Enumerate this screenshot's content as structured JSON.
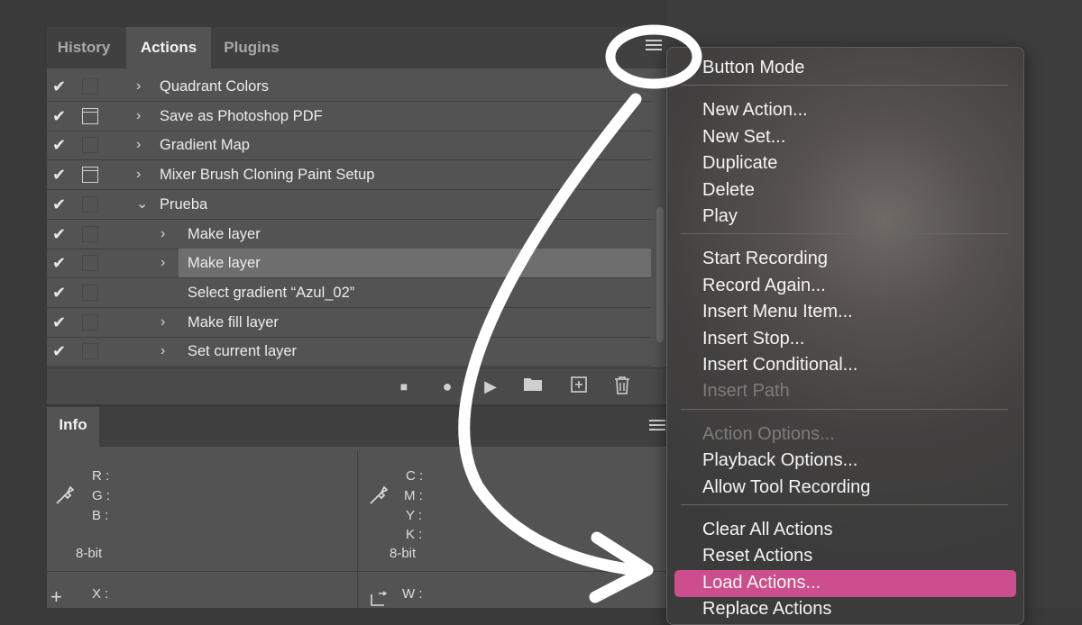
{
  "actions_panel": {
    "tabs": [
      "History",
      "Actions",
      "Plugins"
    ],
    "rows": [
      {
        "label": "Quadrant Colors",
        "chevron": "›",
        "dialog_on": false
      },
      {
        "label": "Save as Photoshop PDF",
        "chevron": "›",
        "dialog_on": true
      },
      {
        "label": "Gradient Map",
        "chevron": "›",
        "dialog_on": false
      },
      {
        "label": "Mixer Brush Cloning Paint Setup",
        "chevron": "›",
        "dialog_on": true
      },
      {
        "label": "Prueba",
        "chevron": "⌄",
        "dialog_on": false
      },
      {
        "label": "Make layer",
        "chevron": "›",
        "dialog_on": false
      },
      {
        "label": "Make layer",
        "chevron": "›",
        "dialog_on": false,
        "selected": true
      },
      {
        "label": "Select gradient “Azul_02”",
        "chevron": "",
        "dialog_on": false
      },
      {
        "label": "Make fill layer",
        "chevron": "›",
        "dialog_on": false
      },
      {
        "label": "Set current layer",
        "chevron": "›",
        "dialog_on": false
      }
    ],
    "check_glyph": "✔",
    "toolbar_icons": [
      "stop-icon",
      "record-icon",
      "play-icon",
      "folder-icon",
      "new-action-icon",
      "trash-icon"
    ],
    "toolbar_glyphs": [
      "■",
      "●",
      "▶",
      "▬",
      "⊞",
      "🗑"
    ]
  },
  "info_panel": {
    "tab": "Info",
    "rgb_labels": [
      "R :",
      "G :",
      "B :"
    ],
    "cmyk_labels": [
      "C :",
      "M :",
      "Y :",
      "K :"
    ],
    "bit_depth_left": "8-bit",
    "bit_depth_right": "8-bit",
    "xy_labels": [
      "X :"
    ],
    "wh_labels": [
      "W :"
    ]
  },
  "flyout_menu": {
    "groups": [
      [
        {
          "label": "Button Mode"
        }
      ],
      [
        {
          "label": "New Action..."
        },
        {
          "label": "New Set..."
        },
        {
          "label": "Duplicate"
        },
        {
          "label": "Delete"
        },
        {
          "label": "Play"
        }
      ],
      [
        {
          "label": "Start Recording"
        },
        {
          "label": "Record Again..."
        },
        {
          "label": "Insert Menu Item..."
        },
        {
          "label": "Insert Stop..."
        },
        {
          "label": "Insert Conditional..."
        },
        {
          "label": "Insert Path",
          "disabled": true
        }
      ],
      [
        {
          "label": "Action Options...",
          "disabled": true
        },
        {
          "label": "Playback Options..."
        },
        {
          "label": "Allow Tool Recording"
        }
      ],
      [
        {
          "label": "Clear All Actions"
        },
        {
          "label": "Reset Actions"
        },
        {
          "label": "Load Actions...",
          "highlighted": true
        },
        {
          "label": "Replace Actions"
        }
      ]
    ],
    "highlight_color": "#cd4e8c"
  },
  "annotation": {
    "color": "#ffffff"
  }
}
